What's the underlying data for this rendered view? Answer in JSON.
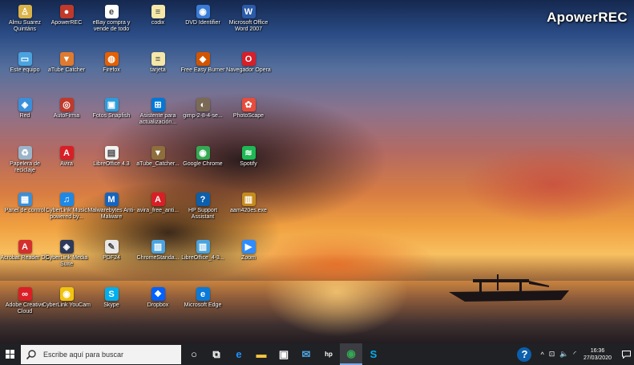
{
  "watermark": "ApowerREC",
  "desktop_icons": [
    {
      "label": "Almu Suarez Quintáns",
      "icon": "user-folder-icon",
      "color": "#d9b34a",
      "glyph": "♙"
    },
    {
      "label": "ApowerREC",
      "icon": "apowerrec-icon",
      "color": "#c0392b",
      "glyph": "●"
    },
    {
      "label": "eBay compra y vende de todo",
      "icon": "ebay-icon",
      "color": "#ffffff",
      "glyph": "e"
    },
    {
      "label": "codix",
      "icon": "text-file-icon",
      "color": "#f5e7a8",
      "glyph": "≡"
    },
    {
      "label": "DVD Identifier",
      "icon": "dvd-icon",
      "color": "#3a7bd5",
      "glyph": "◉"
    },
    {
      "label": "Microsoft Office Word 2007",
      "icon": "word-icon",
      "color": "#2b5aa8",
      "glyph": "W"
    },
    {
      "label": "Este equipo",
      "icon": "computer-icon",
      "color": "#4aa3df",
      "glyph": "▭"
    },
    {
      "label": "aTube Catcher",
      "icon": "atube-icon",
      "color": "#e07a2e",
      "glyph": "▼"
    },
    {
      "label": "Firefox",
      "icon": "firefox-icon",
      "color": "#e66000",
      "glyph": "◍"
    },
    {
      "label": "tarjeta",
      "icon": "text-file-icon",
      "color": "#f5e7a8",
      "glyph": "≡"
    },
    {
      "label": "Free Easy Burner",
      "icon": "burner-icon",
      "color": "#d35400",
      "glyph": "◆"
    },
    {
      "label": "Navegador Opera",
      "icon": "opera-icon",
      "color": "#d81e28",
      "glyph": "O"
    },
    {
      "label": "Red",
      "icon": "network-icon",
      "color": "#3b8fd9",
      "glyph": "◈"
    },
    {
      "label": "AutoFirma",
      "icon": "autofirma-icon",
      "color": "#c0392b",
      "glyph": "◎"
    },
    {
      "label": "Fotos Snapfish",
      "icon": "snapfish-icon",
      "color": "#2d9cdb",
      "glyph": "▣"
    },
    {
      "label": "Asistente para actualización...",
      "icon": "windows-update-icon",
      "color": "#0078d7",
      "glyph": "⊞"
    },
    {
      "label": "gimp-2-8-4-se...",
      "icon": "gimp-icon",
      "color": "#7a6a55",
      "glyph": "◐"
    },
    {
      "label": "PhotoScape",
      "icon": "photoscape-icon",
      "color": "#e74c3c",
      "glyph": "✿"
    },
    {
      "label": "Papelera de reciclaje",
      "icon": "recycle-bin-icon",
      "color": "#9bb4c9",
      "glyph": "♻"
    },
    {
      "label": "Avira",
      "icon": "avira-icon",
      "color": "#d91f26",
      "glyph": "A"
    },
    {
      "label": "LibreOffice 4.3",
      "icon": "libreoffice-icon",
      "color": "#f2f2f2",
      "glyph": "▤"
    },
    {
      "label": "aTube_Catcher...",
      "icon": "atube-icon",
      "color": "#8e6e3c",
      "glyph": "▼"
    },
    {
      "label": "Google Chrome",
      "icon": "chrome-icon",
      "color": "#34a853",
      "glyph": "◉"
    },
    {
      "label": "Spotify",
      "icon": "spotify-icon",
      "color": "#1db954",
      "glyph": "≋"
    },
    {
      "label": "Panel de control",
      "icon": "control-panel-icon",
      "color": "#3a8fd8",
      "glyph": "▦"
    },
    {
      "label": "CyberLink Music powered by...",
      "icon": "cyberlink-music-icon",
      "color": "#1e88e5",
      "glyph": "♫"
    },
    {
      "label": "Malwarebytes Anti-Malware",
      "icon": "malwarebytes-icon",
      "color": "#1565c0",
      "glyph": "M"
    },
    {
      "label": "avira_free_anti...",
      "icon": "avira-icon",
      "color": "#d91f26",
      "glyph": "A"
    },
    {
      "label": "HP Support Assistant",
      "icon": "help-icon",
      "color": "#0b5fad",
      "glyph": "?"
    },
    {
      "label": "aam420es.exe",
      "icon": "installer-icon",
      "color": "#c58b1e",
      "glyph": "▥"
    },
    {
      "label": "Acrobat Reader DC",
      "icon": "acrobat-icon",
      "color": "#d32f2f",
      "glyph": "A"
    },
    {
      "label": "CyberLink Media Suite",
      "icon": "cyberlink-suite-icon",
      "color": "#2e3a59",
      "glyph": "◈"
    },
    {
      "label": "PDF24",
      "icon": "pdf24-icon",
      "color": "#e8e8e8",
      "glyph": "✎"
    },
    {
      "label": "ChromeStanda...",
      "icon": "installer-icon",
      "color": "#4aa3df",
      "glyph": "▥"
    },
    {
      "label": "LibreOffice_4-3...",
      "icon": "installer-icon",
      "color": "#4aa3df",
      "glyph": "▥"
    },
    {
      "label": "Zoom",
      "icon": "zoom-icon",
      "color": "#2d8cff",
      "glyph": "▶"
    },
    {
      "label": "Adobe Creative Cloud",
      "icon": "creative-cloud-icon",
      "color": "#da1f26",
      "glyph": "∞"
    },
    {
      "label": "CyberLink YouCam",
      "icon": "youcam-icon",
      "color": "#f1c40f",
      "glyph": "◉"
    },
    {
      "label": "Skype",
      "icon": "skype-icon",
      "color": "#00aff0",
      "glyph": "S"
    },
    {
      "label": "Dropbox",
      "icon": "dropbox-icon",
      "color": "#0061ff",
      "glyph": "❖"
    },
    {
      "label": "Microsoft Edge",
      "icon": "edge-icon",
      "color": "#0a7ad8",
      "glyph": "e"
    }
  ],
  "taskbar": {
    "search_placeholder": "Escribe aquí para buscar",
    "pinned": [
      {
        "icon": "cortana-icon",
        "color": "#ffffff",
        "glyph": "○"
      },
      {
        "icon": "task-view-icon",
        "color": "#ffffff",
        "glyph": "⧉"
      },
      {
        "icon": "edge-icon",
        "color": "#1e90ff",
        "glyph": "e"
      },
      {
        "icon": "file-explorer-icon",
        "color": "#f4c542",
        "glyph": "▬"
      },
      {
        "icon": "store-icon",
        "color": "#ffffff",
        "glyph": "▣"
      },
      {
        "icon": "mail-icon",
        "color": "#4aa3df",
        "glyph": "✉"
      },
      {
        "icon": "hp-icon",
        "color": "#ffffff",
        "glyph": "hp"
      },
      {
        "icon": "chrome-icon",
        "color": "#34a853",
        "glyph": "◉",
        "active": true
      },
      {
        "icon": "skype-icon",
        "color": "#00aff0",
        "glyph": "S"
      }
    ],
    "tray_icons": [
      {
        "icon": "help-icon",
        "glyph": "?"
      },
      {
        "icon": "chevron-up-icon",
        "glyph": "^"
      },
      {
        "icon": "network-icon",
        "glyph": "⊡"
      },
      {
        "icon": "volume-icon",
        "glyph": "🔈"
      },
      {
        "icon": "wifi-icon",
        "glyph": "◜"
      }
    ],
    "time": "16:36",
    "date": "27/03/2020"
  }
}
